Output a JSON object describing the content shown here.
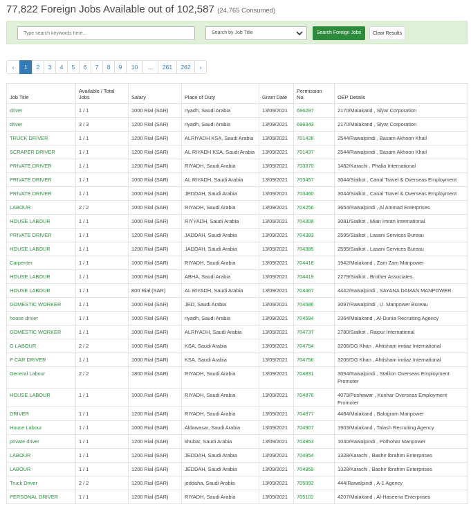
{
  "header": {
    "title": "77,822 Foreign Jobs Available out of 102,587",
    "subtitle": "(24,765 Consumed)"
  },
  "search": {
    "keyword_placeholder": "Type search keywords here...",
    "filter_value": "Search by Job Title",
    "search_button": "Search Foreign Jobs",
    "clear_button": "Clear Results",
    "chevron_icon": "chevron-down-icon"
  },
  "pagination": {
    "prev": "‹",
    "pages": [
      "1",
      "2",
      "3",
      "4",
      "5",
      "6",
      "7",
      "8",
      "9",
      "10",
      "...",
      "261",
      "262"
    ],
    "next": "›",
    "active": "1"
  },
  "table": {
    "headers": [
      "Job Title",
      "Available / Total Jobs",
      "Salary",
      "Place of Duty",
      "Grant Date",
      "Permission No.",
      "OEP Details"
    ],
    "rows": [
      [
        "driver",
        "1 / 1",
        "1000 Rial (SAR)",
        "riyadh, Saudi Arabia",
        "13/09/2021",
        "696297",
        "2170/Malakand , Siyar Corporation"
      ],
      [
        "driver",
        "3 / 3",
        "1200 Rial (SAR)",
        "riyadh, Saudi Arabia",
        "13/09/2021",
        "696343",
        "2170/Malakand , Siyar Corporation"
      ],
      [
        "TRUCK DRIVER",
        "1 / 1",
        "1200 Rial (SAR)",
        "ALRIYADH KSA, Saudi Arabia",
        "13/09/2021",
        "701428",
        "2544/Rawalpindi , Basam Akhoon Khail"
      ],
      [
        "SCRAPER DRIVER",
        "1 / 1",
        "1200 Rial (SAR)",
        "AL RIYADH KSA, Saudi Arabia",
        "13/09/2021",
        "701437",
        "2544/Rawalpindi , Basam Akhoon Khail"
      ],
      [
        "PRIVATE DRIVER",
        "1 / 1",
        "1200 Rial (SAR)",
        "RIYADH, Saudi Arabia",
        "13/09/2021",
        "703370",
        "1482/Karachi , Phalia International"
      ],
      [
        "PRIVATE DRIVER",
        "1 / 1",
        "1000 Rial (SAR)",
        "AL RIYADH, Saudi Arabia",
        "13/09/2021",
        "703457",
        "3044/Sialkot , Canal Travel & Overseas Employment"
      ],
      [
        "PRIVATE DRIVER",
        "1 / 1",
        "1000 Rial (SAR)",
        "JEDDAH, Saudi Arabia",
        "13/09/2021",
        "703460",
        "3044/Sialkot , Canal Travel & Overseas Employment"
      ],
      [
        "LABOUR",
        "2 / 2",
        "1000 Rial (SAR)",
        "RIYADH, Saudi Arabia",
        "13/09/2021",
        "704256",
        "3654/Rawalpindi , Al Ammad Enterprises"
      ],
      [
        "HOUSE LABOUR",
        "1 / 1",
        "1000 Rial (SAR)",
        "RIYYADH, Saudi Arabia",
        "13/09/2021",
        "704308",
        "3081/Sialkot , Mian Imran International"
      ],
      [
        "PRIVATE DRIVER",
        "1 / 1",
        "1200 Rial (SAR)",
        "JADDAH, Saudi Arabia",
        "13/09/2021",
        "704383",
        "2595/Sialkot , Lasani Services Bureau"
      ],
      [
        "HOUSE LABOUR",
        "1 / 1",
        "1200 Rial (SAR)",
        "JADDAH, Saudi Arabia",
        "13/09/2021",
        "704385",
        "2595/Sialkot , Lasani Services Bureau"
      ],
      [
        "Carpenter",
        "1 / 1",
        "1000 Rial (SAR)",
        "RIYADH, Saudi Arabia",
        "13/09/2021",
        "704418",
        "1942/Malakand , Zam Zam Manpower"
      ],
      [
        "HOUSE LABOUR",
        "1 / 1",
        "1000 Rial (SAR)",
        "ABHA, Saudi Arabia",
        "13/09/2021",
        "704419",
        "2279/Sialkot , Brother Associates."
      ],
      [
        "HOUSE LABOUR",
        "1 / 1",
        "800 Rial (SAR)",
        "AL RIYADH, Saudi Arabia",
        "13/09/2021",
        "704467",
        "4442/Rawalpindi , SAYANA DAMAN MANPOWER"
      ],
      [
        "DOMESTIC WORKER",
        "1 / 1",
        "1000 Rial (SAR)",
        "JED, Saudi Arabia",
        "13/09/2021",
        "704586",
        "3097/Rawalpindi , U. Manpower Bureau"
      ],
      [
        "house driver",
        "1 / 1",
        "1000 Rial (SAR)",
        "riyadh, Saudi Arabia",
        "13/09/2021",
        "704594",
        "2364/Malakand , Al-Dunia Recruiting Agency"
      ],
      [
        "DOMESTIC WORKER",
        "1 / 1",
        "1000 Rial (SAR)",
        "ALRIYADH, Saudi Arabia",
        "13/09/2021",
        "704737",
        "2780/Sialkot , Raipur International"
      ],
      [
        "G LABOUR",
        "2 / 2",
        "1000 Rial (SAR)",
        "KSA, Saudi Arabia",
        "13/09/2021",
        "704754",
        "3206/DG Khan , Ahtisham imtiaz International"
      ],
      [
        "P CAR DRIVER",
        "1 / 1",
        "1000 Rial (SAR)",
        "KSA, Saudi Arabia",
        "13/09/2021",
        "704756",
        "3206/DG Khan , Ahtisham imtiaz International"
      ],
      [
        "General Labour",
        "2 / 2",
        "1800 Rial (SAR)",
        "RIYADH, Saudi Arabia",
        "13/09/2021",
        "704831",
        "3094/Rawalpindi , Stallion Overseas Employment Promoter"
      ],
      [
        "HOUSE LABOUR",
        "1 / 1",
        "1000 Rial (SAR)",
        "RIYADH, Saudi Arabia",
        "13/09/2021",
        "704876",
        "4079/Peshawar , Kunhar Overseas Employment Promoter"
      ],
      [
        "DRIVER",
        "1 / 1",
        "1200 Rial (SAR)",
        "RIYADH, Saudi Arabia",
        "13/09/2021",
        "704877",
        "4484/Malakand , Balogram Manpower"
      ],
      [
        "House Labour",
        "1 / 1",
        "1000 Rial (SAR)",
        "Aldawasar, Saudi Arabia",
        "13/09/2021",
        "704907",
        "1903/Malakand , Talash Recruiting Agency"
      ],
      [
        "private driver",
        "1 / 1",
        "1200 Rial (SAR)",
        "khubar, Saudi Arabia",
        "13/09/2021",
        "704953",
        "1040/Rawalpindi , Pothohar Manpower"
      ],
      [
        "LABOUR",
        "1 / 1",
        "1200 Rial (SAR)",
        "JEDDAH, Saudi Arabia",
        "13/09/2021",
        "704954",
        "1328/Karachi , Bashir Ibrahim Enterprises"
      ],
      [
        "LABOUR",
        "1 / 1",
        "1200 Rial (SAR)",
        "JEDDAH, Saudi Arabia",
        "13/09/2021",
        "704959",
        "1328/Karachi , Bashir Ibrahim Enterprises"
      ],
      [
        "Truck Driver",
        "2 / 2",
        "1200 Rial (SAR)",
        "jeddaha, Saudi Arabia",
        "13/09/2021",
        "705092",
        "444/Rawalpindi , A-1 Agency"
      ],
      [
        "PERSONAL DRIVER",
        "1 / 1",
        "1200 Rial (SAR)",
        "RIYADH, Saudi Arabia",
        "13/09/2021",
        "705102",
        "4207/Malakand , Al-Haseena Enterprises"
      ]
    ]
  },
  "colors": {
    "accent_green": "#2e8b3e",
    "search_panel": "#dff0d8",
    "pager_active": "#337ab7"
  }
}
